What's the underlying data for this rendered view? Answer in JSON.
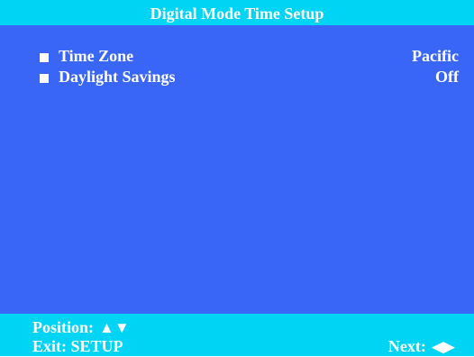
{
  "screen": {
    "title": "Digital Mode Time Setup"
  },
  "menu": {
    "items": [
      {
        "label": "Time Zone",
        "value": "Pacific",
        "bullet_icon": "square-bullet-icon"
      },
      {
        "label": "Daylight Savings",
        "value": "Off",
        "bullet_icon": "square-bullet-icon"
      }
    ]
  },
  "footer": {
    "position_label": "Position:",
    "position_arrows": "▲▼",
    "exit_label": "Exit: SETUP",
    "next_label": "Next:",
    "next_arrows": "◀▶"
  },
  "colors": {
    "background": "#3a66f7",
    "bars": "#00d4f5",
    "text": "#ffffff"
  }
}
